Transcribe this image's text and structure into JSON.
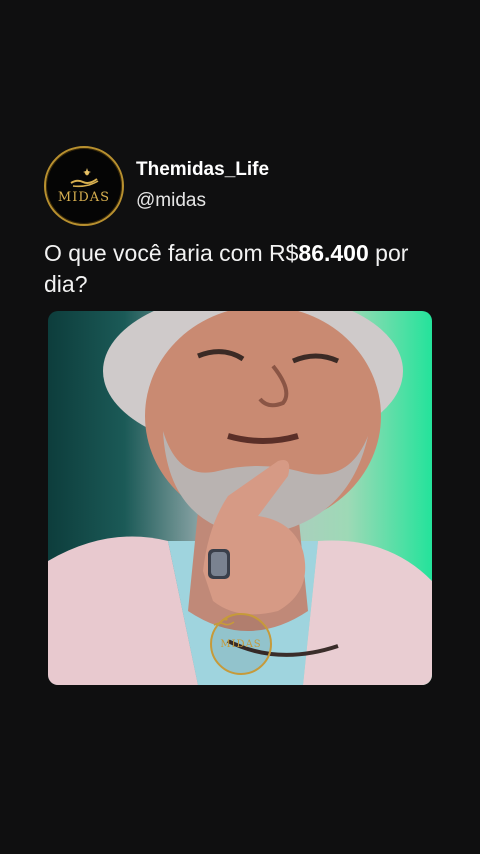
{
  "post": {
    "author": {
      "display_name": "Themidas_Life",
      "handle": "@midas",
      "avatar_icon": "midas-hand-logo-icon",
      "avatar_text": "MIDAS"
    },
    "text_prefix": "O que você faria com R$",
    "text_bold": "86.400",
    "text_suffix": " por dia?",
    "media": {
      "kind": "video-frame",
      "watermark_text": "MIDAS"
    }
  },
  "colors": {
    "background": "#0f0f10",
    "text": "#ffffff",
    "gold": "#c69a3a",
    "media_green": "#24e39b"
  }
}
